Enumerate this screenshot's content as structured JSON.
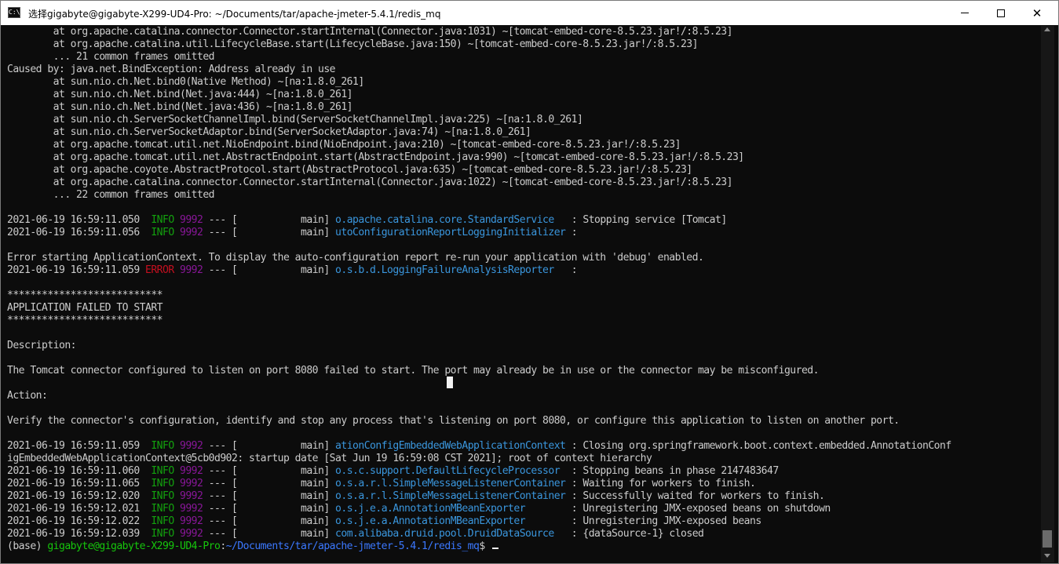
{
  "window": {
    "title": "选择gigabyte@gigabyte-X299-UD4-Pro: ~/Documents/tar/apache-jmeter-5.4.1/redis_mq",
    "icon_name": "terminal-app-icon",
    "controls": {
      "minimize": "minimize-icon",
      "maximize": "maximize-icon",
      "close": "✕"
    }
  },
  "colors": {
    "background": "#0c0c0c",
    "text": "#cccccc",
    "info": "#13a10e",
    "pid": "#881798",
    "error": "#c50f1f",
    "logger": "#3a96dd"
  },
  "lines": [
    [
      {
        "t": "        at org.apache.catalina.connector.Connector.startInternal(Connector.java:1031) ~[tomcat-embed-core-8.5.23.jar!/:8.5.23]"
      }
    ],
    [
      {
        "t": "        at org.apache.catalina.util.LifecycleBase.start(LifecycleBase.java:150) ~[tomcat-embed-core-8.5.23.jar!/:8.5.23]"
      }
    ],
    [
      {
        "t": "        ... 21 common frames omitted"
      }
    ],
    [
      {
        "t": "Caused by: java.net.BindException: Address already in use"
      }
    ],
    [
      {
        "t": "        at sun.nio.ch.Net.bind0(Native Method) ~[na:1.8.0_261]"
      }
    ],
    [
      {
        "t": "        at sun.nio.ch.Net.bind(Net.java:444) ~[na:1.8.0_261]"
      }
    ],
    [
      {
        "t": "        at sun.nio.ch.Net.bind(Net.java:436) ~[na:1.8.0_261]"
      }
    ],
    [
      {
        "t": "        at sun.nio.ch.ServerSocketChannelImpl.bind(ServerSocketChannelImpl.java:225) ~[na:1.8.0_261]"
      }
    ],
    [
      {
        "t": "        at sun.nio.ch.ServerSocketAdaptor.bind(ServerSocketAdaptor.java:74) ~[na:1.8.0_261]"
      }
    ],
    [
      {
        "t": "        at org.apache.tomcat.util.net.NioEndpoint.bind(NioEndpoint.java:210) ~[tomcat-embed-core-8.5.23.jar!/:8.5.23]"
      }
    ],
    [
      {
        "t": "        at org.apache.tomcat.util.net.AbstractEndpoint.start(AbstractEndpoint.java:990) ~[tomcat-embed-core-8.5.23.jar!/:8.5.23]"
      }
    ],
    [
      {
        "t": "        at org.apache.coyote.AbstractProtocol.start(AbstractProtocol.java:635) ~[tomcat-embed-core-8.5.23.jar!/:8.5.23]"
      }
    ],
    [
      {
        "t": "        at org.apache.catalina.connector.Connector.startInternal(Connector.java:1022) ~[tomcat-embed-core-8.5.23.jar!/:8.5.23]"
      }
    ],
    [
      {
        "t": "        ... 22 common frames omitted"
      }
    ],
    [
      {
        "t": ""
      }
    ],
    [
      {
        "t": "2021-06-19 16:59:11.050  "
      },
      {
        "t": "INFO",
        "c": "green"
      },
      {
        "t": " "
      },
      {
        "t": "9992",
        "c": "magenta"
      },
      {
        "t": " --- [           main] "
      },
      {
        "t": "o.apache.catalina.core.StandardService  ",
        "c": "cyan"
      },
      {
        "t": " : Stopping service [Tomcat]"
      }
    ],
    [
      {
        "t": "2021-06-19 16:59:11.056  "
      },
      {
        "t": "INFO",
        "c": "green"
      },
      {
        "t": " "
      },
      {
        "t": "9992",
        "c": "magenta"
      },
      {
        "t": " --- [           main] "
      },
      {
        "t": "utoConfigurationReportLoggingInitializer",
        "c": "cyan"
      },
      {
        "t": " :"
      }
    ],
    [
      {
        "t": ""
      }
    ],
    [
      {
        "t": "Error starting ApplicationContext. To display the auto-configuration report re-run your application with 'debug' enabled."
      }
    ],
    [
      {
        "t": "2021-06-19 16:59:11.059 "
      },
      {
        "t": "ERROR",
        "c": "red"
      },
      {
        "t": " "
      },
      {
        "t": "9992",
        "c": "magenta"
      },
      {
        "t": " --- [           main] "
      },
      {
        "t": "o.s.b.d.LoggingFailureAnalysisReporter  ",
        "c": "cyan"
      },
      {
        "t": " :"
      }
    ],
    [
      {
        "t": ""
      }
    ],
    [
      {
        "t": "***************************"
      }
    ],
    [
      {
        "t": "APPLICATION FAILED TO START"
      }
    ],
    [
      {
        "t": "***************************"
      }
    ],
    [
      {
        "t": ""
      }
    ],
    [
      {
        "t": "Description:"
      }
    ],
    [
      {
        "t": ""
      }
    ],
    [
      {
        "t": "The Tomcat connector configured to listen on port 8080 failed to start. The port may already be in use or the connector may be misconfigured."
      }
    ],
    [
      {
        "t": ""
      }
    ],
    [
      {
        "t": "Action:"
      }
    ],
    [
      {
        "t": ""
      }
    ],
    [
      {
        "t": "Verify the connector's configuration, identify and stop any process that's listening on port 8080, or configure this application to listen on another port."
      }
    ],
    [
      {
        "t": ""
      }
    ],
    [
      {
        "t": "2021-06-19 16:59:11.059  "
      },
      {
        "t": "INFO",
        "c": "green"
      },
      {
        "t": " "
      },
      {
        "t": "9992",
        "c": "magenta"
      },
      {
        "t": " --- [           main] "
      },
      {
        "t": "ationConfigEmbeddedWebApplicationContext",
        "c": "cyan"
      },
      {
        "t": " : Closing org.springframework.boot.context.embedded.AnnotationConf"
      }
    ],
    [
      {
        "t": "igEmbeddedWebApplicationContext@5cb0d902: startup date [Sat Jun 19 16:59:08 CST 2021]; root of context hierarchy"
      }
    ],
    [
      {
        "t": "2021-06-19 16:59:11.060  "
      },
      {
        "t": "INFO",
        "c": "green"
      },
      {
        "t": " "
      },
      {
        "t": "9992",
        "c": "magenta"
      },
      {
        "t": " --- [           main] "
      },
      {
        "t": "o.s.c.support.DefaultLifecycleProcessor ",
        "c": "cyan"
      },
      {
        "t": " : Stopping beans in phase 2147483647"
      }
    ],
    [
      {
        "t": "2021-06-19 16:59:11.065  "
      },
      {
        "t": "INFO",
        "c": "green"
      },
      {
        "t": " "
      },
      {
        "t": "9992",
        "c": "magenta"
      },
      {
        "t": " --- [           main] "
      },
      {
        "t": "o.s.a.r.l.SimpleMessageListenerContainer",
        "c": "cyan"
      },
      {
        "t": " : Waiting for workers to finish."
      }
    ],
    [
      {
        "t": "2021-06-19 16:59:12.020  "
      },
      {
        "t": "INFO",
        "c": "green"
      },
      {
        "t": " "
      },
      {
        "t": "9992",
        "c": "magenta"
      },
      {
        "t": " --- [           main] "
      },
      {
        "t": "o.s.a.r.l.SimpleMessageListenerContainer",
        "c": "cyan"
      },
      {
        "t": " : Successfully waited for workers to finish."
      }
    ],
    [
      {
        "t": "2021-06-19 16:59:12.021  "
      },
      {
        "t": "INFO",
        "c": "green"
      },
      {
        "t": " "
      },
      {
        "t": "9992",
        "c": "magenta"
      },
      {
        "t": " --- [           main] "
      },
      {
        "t": "o.s.j.e.a.AnnotationMBeanExporter       ",
        "c": "cyan"
      },
      {
        "t": " : Unregistering JMX-exposed beans on shutdown"
      }
    ],
    [
      {
        "t": "2021-06-19 16:59:12.022  "
      },
      {
        "t": "INFO",
        "c": "green"
      },
      {
        "t": " "
      },
      {
        "t": "9992",
        "c": "magenta"
      },
      {
        "t": " --- [           main] "
      },
      {
        "t": "o.s.j.e.a.AnnotationMBeanExporter       ",
        "c": "cyan"
      },
      {
        "t": " : Unregistering JMX-exposed beans"
      }
    ],
    [
      {
        "t": "2021-06-19 16:59:12.039  "
      },
      {
        "t": "INFO",
        "c": "green"
      },
      {
        "t": " "
      },
      {
        "t": "9992",
        "c": "magenta"
      },
      {
        "t": " --- [           main] "
      },
      {
        "t": "com.alibaba.druid.pool.DruidDataSource  ",
        "c": "cyan"
      },
      {
        "t": " : {dataSource-1} closed"
      }
    ]
  ],
  "prompt": {
    "env": "(base) ",
    "user_host": "gigabyte@gigabyte-X299-UD4-Pro",
    "sep": ":",
    "path": "~/Documents/tar/apache-jmeter-5.4.1/redis_mq",
    "symbol": "$ "
  }
}
